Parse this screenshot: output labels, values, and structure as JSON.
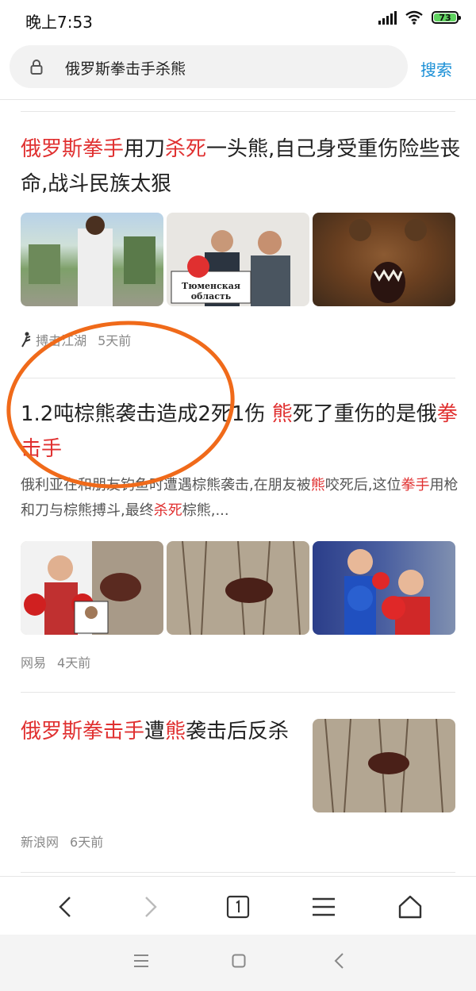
{
  "status": {
    "time": "晚上7:53",
    "battery": "73"
  },
  "search": {
    "query": "俄罗斯拳击手杀熊",
    "button": "搜索"
  },
  "results": [
    {
      "title_parts": [
        {
          "text": "俄罗斯拳手",
          "hl": true
        },
        {
          "text": "用刀",
          "hl": false
        },
        {
          "text": "杀死",
          "hl": true
        },
        {
          "text": "一头熊,自己身受重伤险些丧命,战斗民族太狠",
          "hl": false
        }
      ],
      "source": "搏击江湖",
      "time": "5天前"
    },
    {
      "title_parts": [
        {
          "text": "1.2吨棕熊袭击造成2死1伤 ",
          "hl": false
        },
        {
          "text": "熊",
          "hl": true
        },
        {
          "text": "死了重伤的是俄",
          "hl": false
        },
        {
          "text": "拳击手",
          "hl": true
        }
      ],
      "desc_parts": [
        {
          "text": "俄利亚在和朋友钓鱼时遭遇棕熊袭击,在朋友被",
          "hl": false
        },
        {
          "text": "熊",
          "hl": true
        },
        {
          "text": "咬死后,这位",
          "hl": false
        },
        {
          "text": "拳手",
          "hl": true
        },
        {
          "text": "用枪和刀与棕熊搏斗,最终",
          "hl": false
        },
        {
          "text": "杀死",
          "hl": true
        },
        {
          "text": "棕熊,...",
          "hl": false
        }
      ],
      "source": "网易",
      "time": "4天前"
    },
    {
      "title_parts": [
        {
          "text": "俄罗斯拳击手",
          "hl": true
        },
        {
          "text": "遭",
          "hl": false
        },
        {
          "text": "熊",
          "hl": true
        },
        {
          "text": "袭击后反杀",
          "hl": false
        }
      ],
      "source": "新浪网",
      "time": "6天前"
    }
  ],
  "image_captions": {
    "sign": "Тюменская область"
  },
  "colors": {
    "highlight": "#e03030",
    "link": "#1a8fd6",
    "circle": "#f06a1a",
    "battery": "#5fd35f"
  }
}
